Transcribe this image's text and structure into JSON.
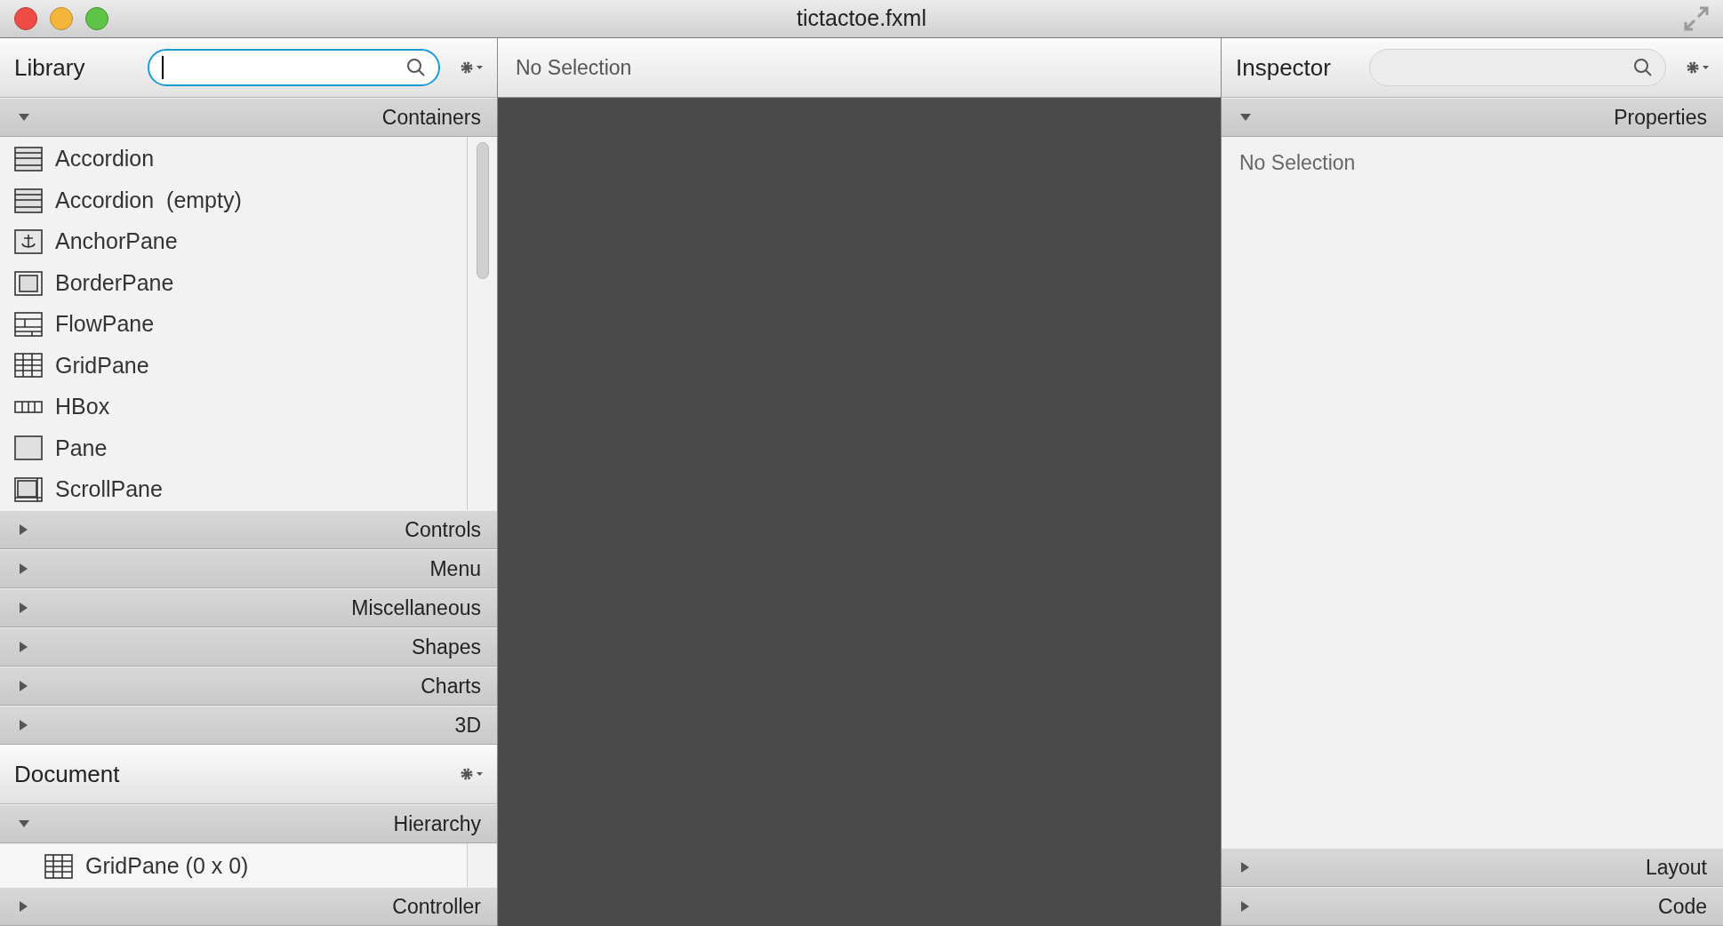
{
  "window": {
    "title": "tictactoe.fxml"
  },
  "library": {
    "title": "Library",
    "search": {
      "focused": true
    },
    "sections": [
      {
        "label": "Containers",
        "expanded": true,
        "items": [
          {
            "label": "Accordion",
            "kind": "accordion"
          },
          {
            "label": "Accordion  (empty)",
            "kind": "accordion"
          },
          {
            "label": "AnchorPane",
            "kind": "anchor"
          },
          {
            "label": "BorderPane",
            "kind": "border"
          },
          {
            "label": "FlowPane",
            "kind": "flow"
          },
          {
            "label": "GridPane",
            "kind": "grid"
          },
          {
            "label": "HBox",
            "kind": "hbox"
          },
          {
            "label": "Pane",
            "kind": "pane"
          },
          {
            "label": "ScrollPane",
            "kind": "scroll"
          }
        ]
      },
      {
        "label": "Controls",
        "expanded": false
      },
      {
        "label": "Menu",
        "expanded": false
      },
      {
        "label": "Miscellaneous",
        "expanded": false
      },
      {
        "label": "Shapes",
        "expanded": false
      },
      {
        "label": "Charts",
        "expanded": false
      },
      {
        "label": "3D",
        "expanded": false
      }
    ]
  },
  "document": {
    "title": "Document",
    "sections": [
      {
        "label": "Hierarchy",
        "expanded": true,
        "items": [
          {
            "label": "GridPane (0 x 0)",
            "kind": "grid"
          }
        ]
      },
      {
        "label": "Controller",
        "expanded": false
      }
    ]
  },
  "canvas": {
    "header": "No Selection"
  },
  "inspector": {
    "title": "Inspector",
    "search": {
      "focused": false
    },
    "sections": [
      {
        "label": "Properties",
        "expanded": true,
        "message": "No Selection"
      },
      {
        "label": "Layout",
        "expanded": false
      },
      {
        "label": "Code",
        "expanded": false
      }
    ]
  }
}
